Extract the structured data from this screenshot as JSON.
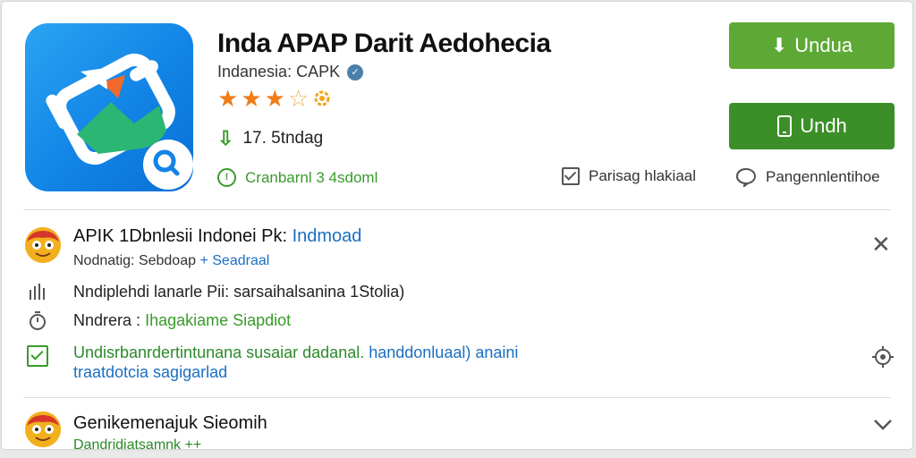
{
  "app": {
    "title": "Inda APAP Darit Aedohecia",
    "developer": "Indanesia: CAPK",
    "downloads": "17. 5tndag",
    "rating_link": "Cranbarnl 3 4sdoml"
  },
  "buttons": {
    "primary": "Undua",
    "secondary": "Undh"
  },
  "actions": {
    "wishlist": "Parisag hlakiaal",
    "comments": "Pangennlentihoe"
  },
  "rows": {
    "first": {
      "title": "APIK 1Dbnlesii Indonei Pk:",
      "title_link": "Indmoad",
      "sub_prefix": "Nodnatig: Sebdoap",
      "sub_link": "Seadraal",
      "stats_line": "Nndiplehdi lanarle Pii: sarsaihalsanina 1Stolia)",
      "time_label": "Nndrera :",
      "time_value": "Ihagakiame Siapdiot",
      "desc_line1_green": "Undisrbanrdertintunana susaiar dadanal.",
      "desc_line1_blue": "handdonluaal) anaini",
      "desc_line2": "traatdotcia sagigarlad"
    },
    "second": {
      "title": "Genikemenajuk Sieomih",
      "sub": "Dandridiatsamnk ++"
    }
  }
}
